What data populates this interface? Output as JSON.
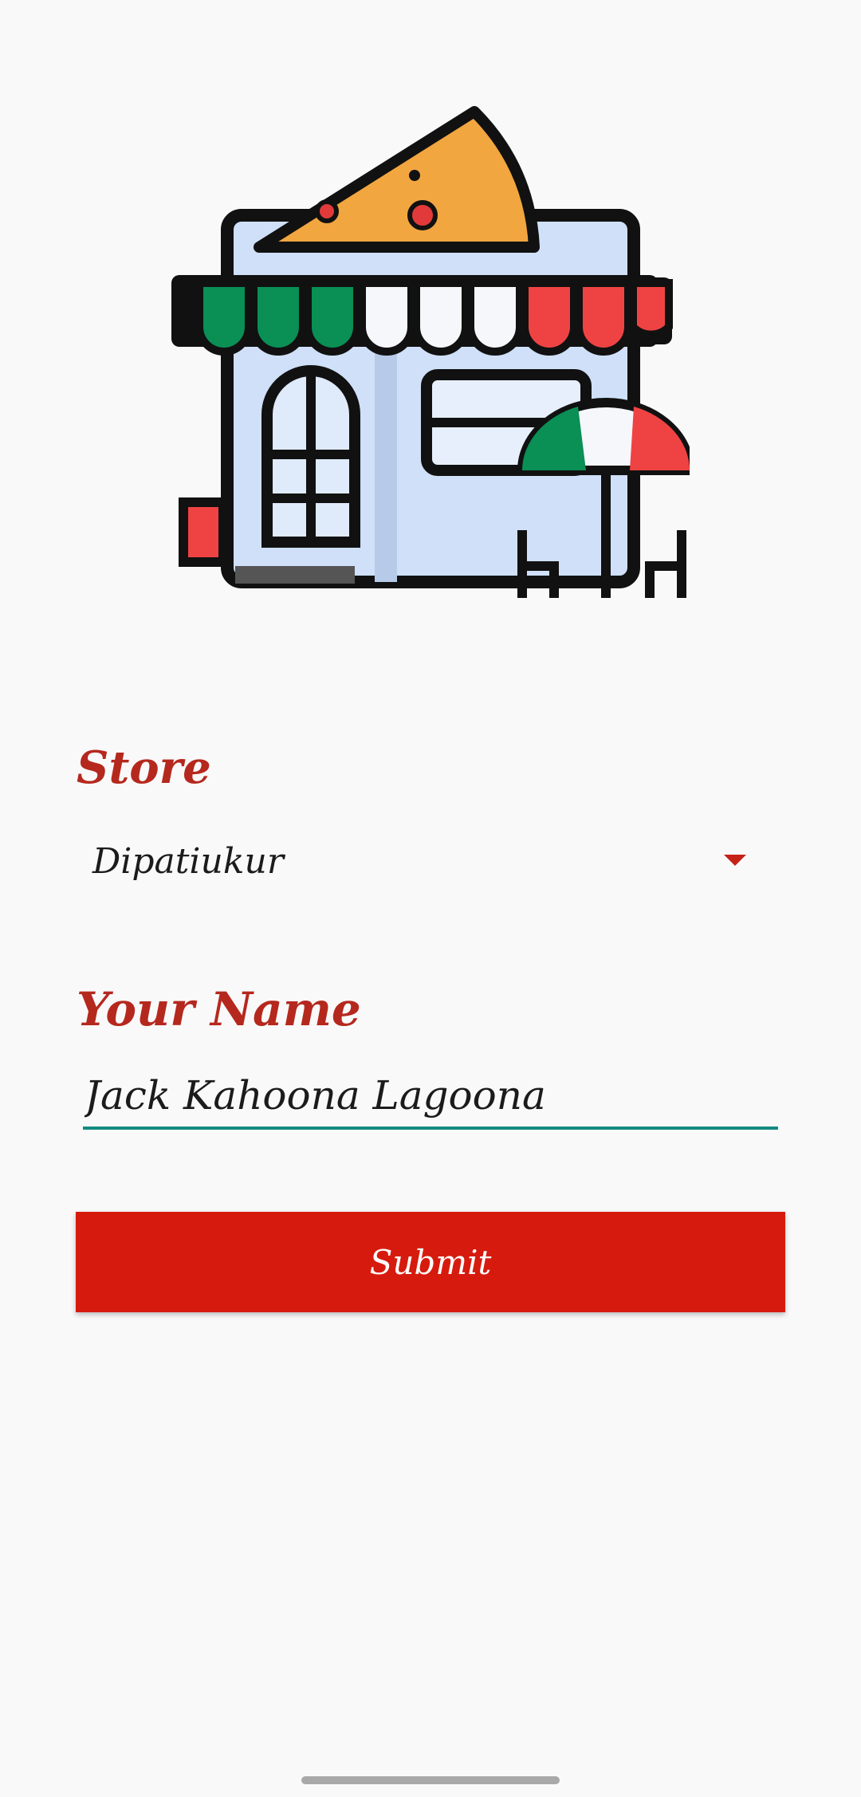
{
  "logo": {
    "icon": "pizza-store-icon"
  },
  "form": {
    "store_label": "Store",
    "store_value": "Dipatiukur",
    "name_label": "Your Name",
    "name_value": "Jack Kahoona Lagoona",
    "submit_label": "Submit"
  },
  "colors": {
    "accent": "#b5281e",
    "button": "#d61b0e",
    "underline": "#138a7f",
    "background": "#f9f9f9"
  }
}
